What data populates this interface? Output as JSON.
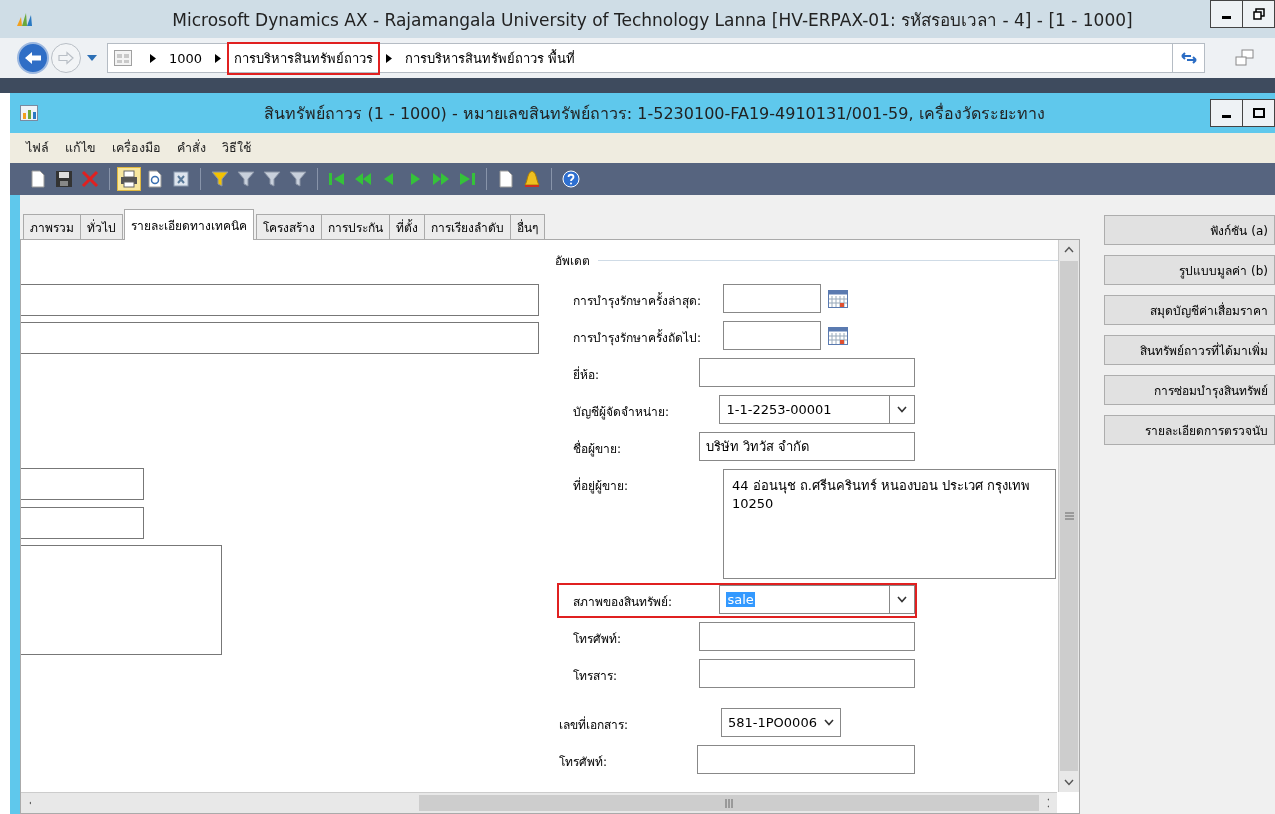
{
  "window": {
    "title": "Microsoft Dynamics AX - Rajamangala University of Technology Lanna [HV-ERPAX-01: รหัสรอบเวลา - 4] - [1 - 1000]"
  },
  "breadcrumb": [
    {
      "label": "1000",
      "highlighted": false
    },
    {
      "label": "การบริหารสินทรัพย์ถาวร",
      "highlighted": true
    },
    {
      "label": "การบริหารสินทรัพย์ถาวร พื้นที่",
      "highlighted": false
    }
  ],
  "form": {
    "title": "สินทรัพย์ถาวร (1 - 1000) - หมายเลขสินทรัพย์ถาวร: 1-5230100-FA19-4910131/001-59, เครื่องวัดระยะทาง",
    "menu": [
      "ไฟล์",
      "แก้ไข",
      "เครื่องมือ",
      "คำสั่ง",
      "วิธีใช้"
    ],
    "tabs": [
      {
        "label": "ภาพรวม",
        "selected": false
      },
      {
        "label": "ทั่วไป",
        "selected": false
      },
      {
        "label": "รายละเอียดทางเทคนิค",
        "selected": true
      },
      {
        "label": "โครงสร้าง",
        "selected": false
      },
      {
        "label": "การประกัน",
        "selected": false
      },
      {
        "label": "ที่ตั้ง",
        "selected": false
      },
      {
        "label": "การเรียงลำดับ",
        "selected": false
      },
      {
        "label": "อื่นๆ",
        "selected": false
      }
    ],
    "group_title": "อัพเดต",
    "group_fields": [
      {
        "label": "การบำรุงรักษาครั้งล่าสุด:",
        "kind": "date",
        "highlighted": false
      },
      {
        "label": "การบำรุงรักษาครั้งถัดไป:",
        "kind": "date",
        "highlighted": false
      },
      {
        "label": "ยี่ห้อ:",
        "kind": "text",
        "highlighted": false
      },
      {
        "label": "บัญชีผู้จัดจำหน่าย:",
        "kind": "combo",
        "value": "1-1-2253-00001",
        "highlighted": false
      },
      {
        "label": "ชื่อผู้ขาย:",
        "kind": "text",
        "value": "บริษัท วิทวัส จำกัด",
        "highlighted": false
      },
      {
        "label": "ที่อยู่ผู้ขาย:",
        "kind": "textarea",
        "value": "44 อ่อนนุช ถ.ศรีนครินทร์ หนองบอน ประเวศ กรุงเทพ\n10250",
        "highlighted": false
      },
      {
        "label": "สภาพของสินทรัพย์:",
        "kind": "combo",
        "value": "sale",
        "value_selected": true,
        "highlighted": true
      },
      {
        "label": "โทรศัพท์:",
        "kind": "text",
        "highlighted": false
      },
      {
        "label": "โทรสาร:",
        "kind": "text",
        "highlighted": false
      }
    ],
    "fields": [
      {
        "label": "เลขที่เอกสาร:",
        "kind": "smallcombo",
        "value": "581-1PO0006"
      },
      {
        "label": "โทรศัพท์:",
        "kind": "text"
      }
    ],
    "buttons": [
      "ฟังก์ชัน (a)",
      "รูปแบบมูลค่า (b)",
      "สมุดบัญชีค่าเสื่อมราคา",
      "สินทรัพย์ถาวรที่ได้มาเพิ่ม",
      "การซ่อมบำรุงสินทรัพย์",
      "รายละเอียดการตรวจนับ"
    ]
  }
}
